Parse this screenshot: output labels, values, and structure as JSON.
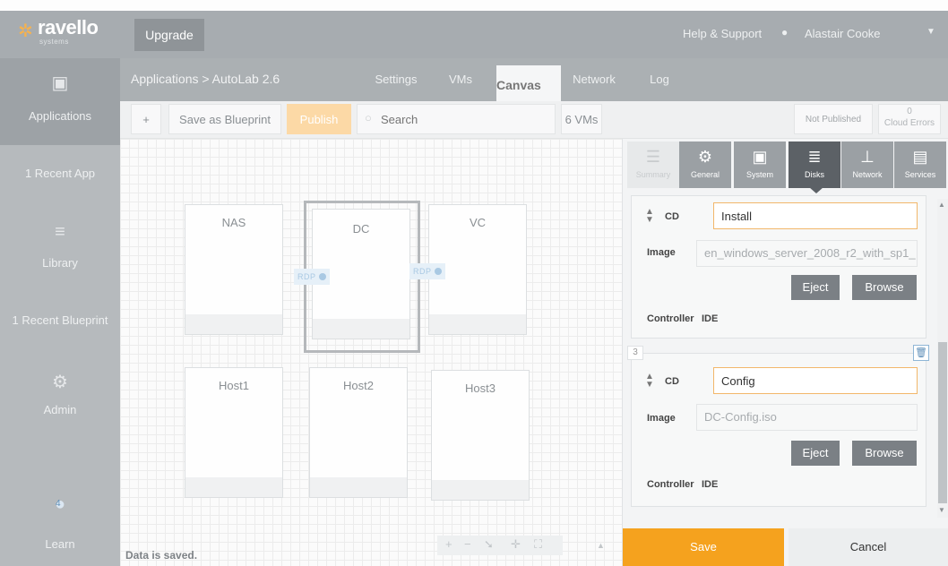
{
  "brand": {
    "name": "ravello",
    "tagline": "systems"
  },
  "topbar": {
    "upgrade": "Upgrade",
    "help": "Help & Support",
    "user": "Alastair Cooke"
  },
  "sidebar": {
    "applications": "Applications",
    "recent_app": "1 Recent App",
    "library": "Library",
    "recent_blueprint": "1 Recent Blueprint",
    "admin": "Admin",
    "learn": "Learn",
    "learn_badge": "4"
  },
  "subheader": {
    "breadcrumb": "Applications > AutoLab 2.6",
    "tabs": [
      "Settings",
      "VMs",
      "Canvas",
      "Network",
      "Log"
    ]
  },
  "toolbar": {
    "add": "+",
    "save_blueprint": "Save as Blueprint",
    "publish": "Publish",
    "search_placeholder": "Search",
    "vm_count": "6 VMs",
    "status": "Not Published",
    "cloud_errors_count": "0",
    "cloud_errors": "Cloud Errors"
  },
  "canvas": {
    "vms": [
      "NAS",
      "DC",
      "VC",
      "Host1",
      "Host2",
      "Host3"
    ],
    "rdp": "RDP",
    "saved": "Data is saved."
  },
  "panel": {
    "tabs": [
      "Summary",
      "General",
      "System",
      "Disks",
      "Network",
      "Services"
    ],
    "disk_top": {
      "type": "CD",
      "name": "Install",
      "image_label": "Image",
      "image": "en_windows_server_2008_r2_with_sp1_",
      "eject": "Eject",
      "browse": "Browse",
      "controller_label": "Controller",
      "controller": "IDE"
    },
    "disk_3": {
      "index": "3",
      "type": "CD",
      "name": "Config",
      "image_label": "Image",
      "image": "DC-Config.iso",
      "eject": "Eject",
      "browse": "Browse",
      "controller_label": "Controller",
      "controller": "IDE"
    },
    "save": "Save",
    "cancel": "Cancel"
  },
  "colors": {
    "accent": "#f5a21e",
    "active_tab": "#5c6166",
    "topbar": "#a7acb0"
  }
}
